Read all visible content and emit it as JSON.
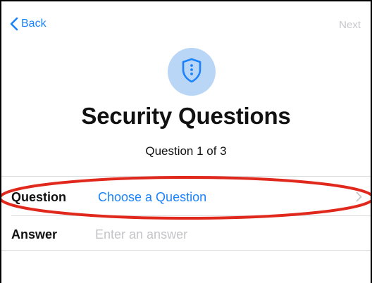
{
  "nav": {
    "back_label": "Back",
    "next_label": "Next"
  },
  "header": {
    "icon": "shield-icon",
    "title": "Security Questions",
    "subtitle": "Question 1 of 3"
  },
  "form": {
    "question": {
      "label": "Question",
      "value": "Choose a Question"
    },
    "answer": {
      "label": "Answer",
      "value": "",
      "placeholder": "Enter an answer"
    }
  },
  "colors": {
    "accent": "#1a82fb",
    "icon_background": "#b9d6f7",
    "disabled_text": "#c7c7cc",
    "highlight_annotation": "#e0281c"
  }
}
